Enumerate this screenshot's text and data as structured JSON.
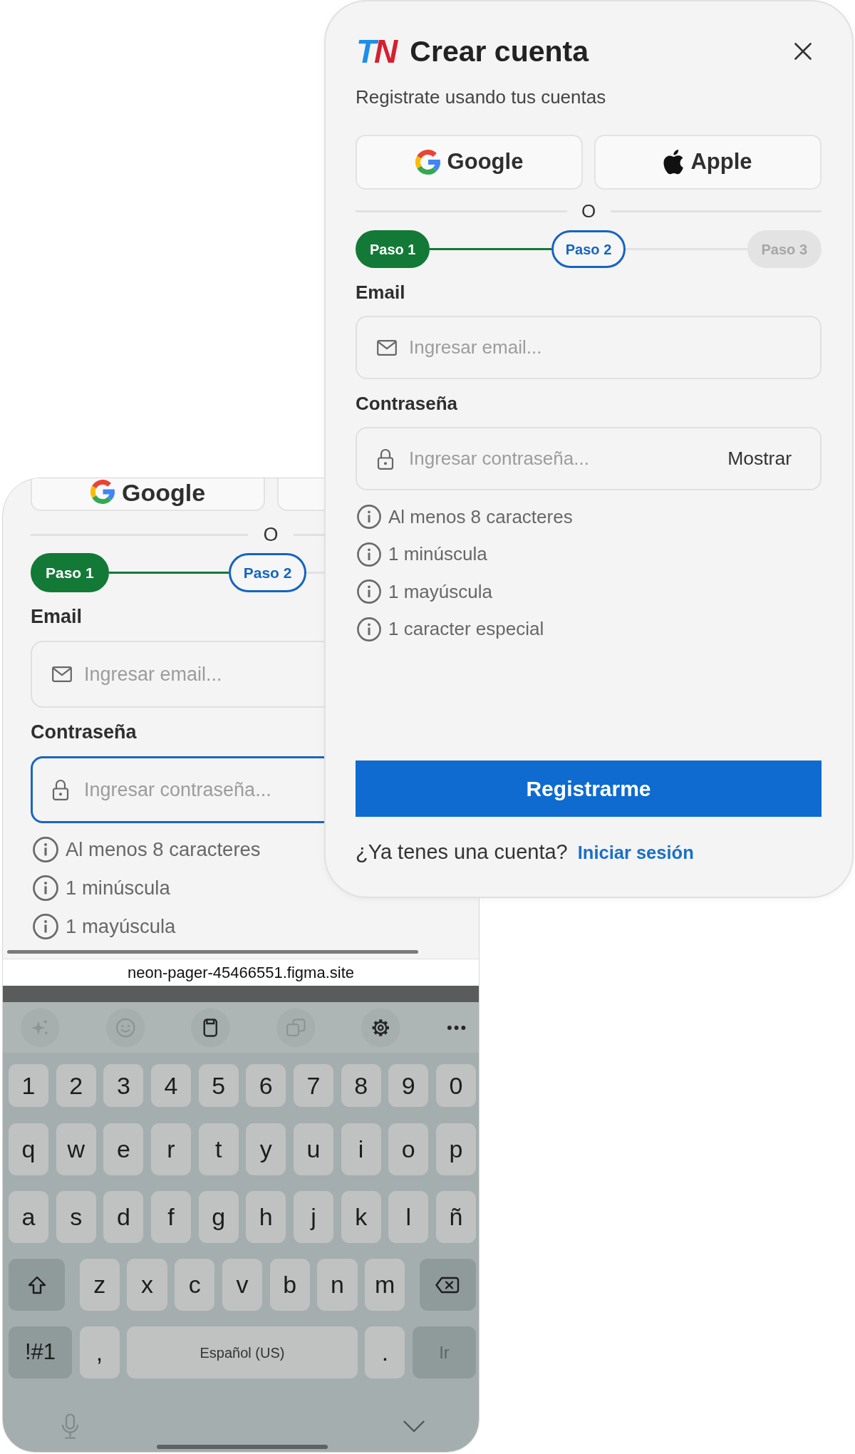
{
  "dialog": {
    "logo": "TN",
    "title": "Crear cuenta",
    "subtitle": "Registrate usando tus cuentas",
    "social_buttons": [
      {
        "kind": "google",
        "label": "Google"
      },
      {
        "kind": "apple",
        "label": "Apple"
      }
    ],
    "divider": "O",
    "steps": [
      {
        "label": "Paso 1",
        "completed": true,
        "selected": false
      },
      {
        "label": "Paso 2",
        "completed": false,
        "selected": true
      },
      {
        "label": "Paso 3",
        "completed": false,
        "selected": false
      }
    ],
    "fields": [
      {
        "kind": "email",
        "label": "Email",
        "placeholder": "Ingresar email...",
        "focused": false
      },
      {
        "kind": "password",
        "label": "Contraseña",
        "placeholder": "Ingresar contraseña...",
        "toggle": "Mostrar",
        "focused": false
      }
    ],
    "hints": [
      "Al menos 8 caracteres",
      "1 minúscula",
      "1 mayúscula",
      "1 caracter especial"
    ],
    "submit": "Registrarme",
    "footer": {
      "prompt": "¿Ya tenes una cuenta?",
      "link": "Iniciar sesión"
    }
  },
  "phone": {
    "social_buttons": [
      {
        "kind": "google",
        "label": "Google"
      }
    ],
    "divider": "O",
    "steps": [
      {
        "label": "Paso 1",
        "completed": true,
        "selected": false
      },
      {
        "label": "Paso 2",
        "completed": false,
        "selected": true
      }
    ],
    "fields": [
      {
        "kind": "email",
        "label": "Email",
        "placeholder": "Ingresar email...",
        "focused": false
      },
      {
        "kind": "password",
        "label": "Contraseña",
        "placeholder": "Ingresar contraseña...",
        "focused": true
      }
    ],
    "hints": [
      "Al menos 8 caracteres",
      "1 minúscula",
      "1 mayúscula"
    ],
    "url": "neon-pager-45466551.figma.site",
    "keyboard": {
      "toolbar": [
        {
          "kind": "sparkle",
          "disabled": true
        },
        {
          "kind": "emoji",
          "disabled": true
        },
        {
          "kind": "clipboard",
          "disabled": false
        },
        {
          "kind": "translate",
          "disabled": true
        },
        {
          "kind": "settings",
          "disabled": false
        },
        {
          "kind": "more",
          "disabled": false
        }
      ],
      "rows": [
        {
          "keys": [
            {
              "kind": "char",
              "label": "1"
            },
            {
              "kind": "char",
              "label": "2"
            },
            {
              "kind": "char",
              "label": "3"
            },
            {
              "kind": "char",
              "label": "4"
            },
            {
              "kind": "char",
              "label": "5"
            },
            {
              "kind": "char",
              "label": "6"
            },
            {
              "kind": "char",
              "label": "7"
            },
            {
              "kind": "char",
              "label": "8"
            },
            {
              "kind": "char",
              "label": "9"
            },
            {
              "kind": "char",
              "label": "0"
            }
          ]
        },
        {
          "keys": [
            {
              "kind": "char",
              "label": "q"
            },
            {
              "kind": "char",
              "label": "w"
            },
            {
              "kind": "char",
              "label": "e"
            },
            {
              "kind": "char",
              "label": "r"
            },
            {
              "kind": "char",
              "label": "t"
            },
            {
              "kind": "char",
              "label": "y"
            },
            {
              "kind": "char",
              "label": "u"
            },
            {
              "kind": "char",
              "label": "i"
            },
            {
              "kind": "char",
              "label": "o"
            },
            {
              "kind": "char",
              "label": "p"
            }
          ]
        },
        {
          "keys": [
            {
              "kind": "char",
              "label": "a"
            },
            {
              "kind": "char",
              "label": "s"
            },
            {
              "kind": "char",
              "label": "d"
            },
            {
              "kind": "char",
              "label": "f"
            },
            {
              "kind": "char",
              "label": "g"
            },
            {
              "kind": "char",
              "label": "h"
            },
            {
              "kind": "char",
              "label": "j"
            },
            {
              "kind": "char",
              "label": "k"
            },
            {
              "kind": "char",
              "label": "l"
            },
            {
              "kind": "char",
              "label": "ñ"
            }
          ]
        },
        {
          "keys": [
            {
              "kind": "shift"
            },
            {
              "kind": "char",
              "label": "z"
            },
            {
              "kind": "char",
              "label": "x"
            },
            {
              "kind": "char",
              "label": "c"
            },
            {
              "kind": "char",
              "label": "v"
            },
            {
              "kind": "char",
              "label": "b"
            },
            {
              "kind": "char",
              "label": "n"
            },
            {
              "kind": "char",
              "label": "m"
            },
            {
              "kind": "backspace"
            }
          ]
        },
        {
          "keys": [
            {
              "kind": "symbols",
              "label": "!#1"
            },
            {
              "kind": "char",
              "label": ","
            },
            {
              "kind": "space",
              "label": "Español (US)"
            },
            {
              "kind": "char",
              "label": "."
            },
            {
              "kind": "enter",
              "label": "Ir"
            }
          ]
        }
      ]
    }
  }
}
